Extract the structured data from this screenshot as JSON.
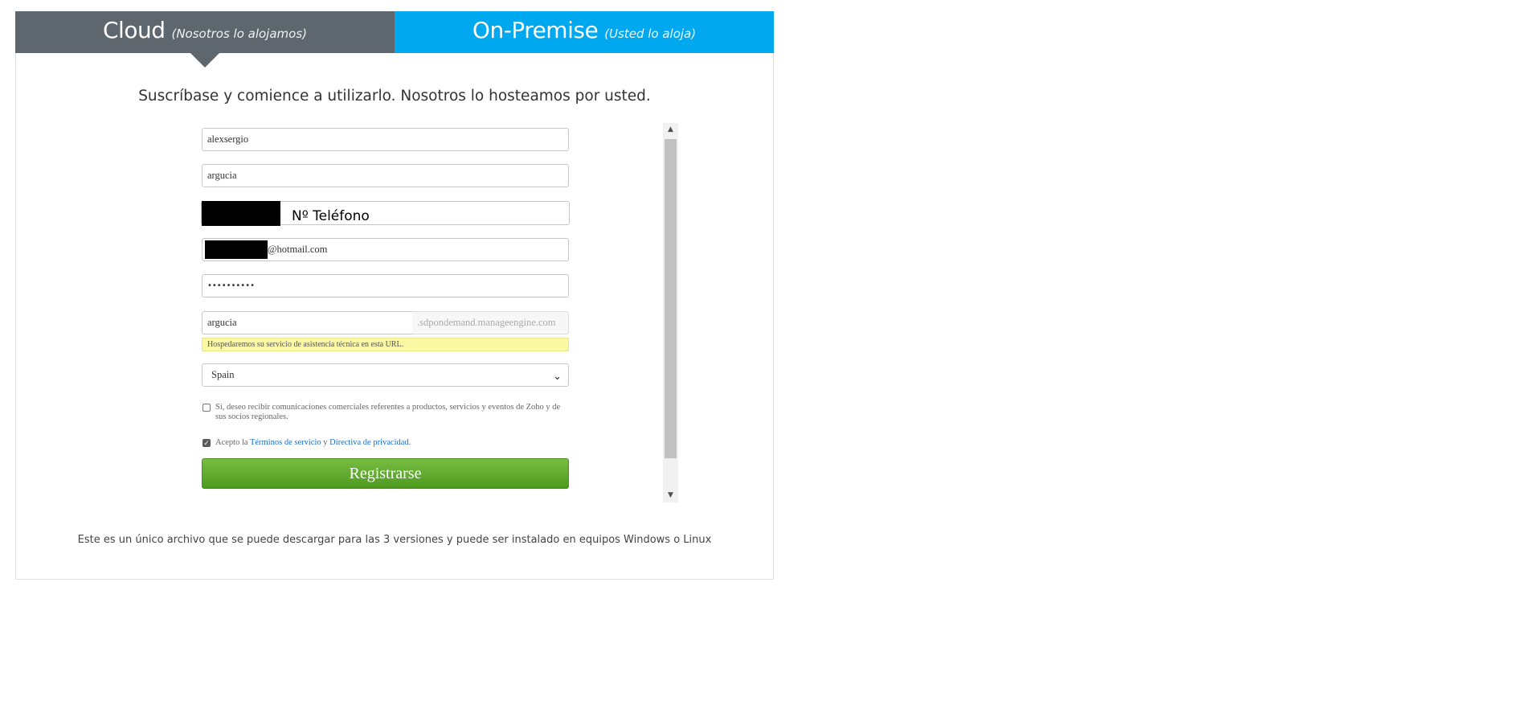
{
  "tabs": {
    "cloud": {
      "title": "Cloud",
      "subtitle": "(Nosotros lo alojamos)"
    },
    "onpremise": {
      "title": "On-Premise",
      "subtitle": "(Usted lo aloja)"
    }
  },
  "headline": "Suscríbase y comience a utilizarlo. Nosotros lo hosteamos por usted.",
  "form": {
    "name_value": "alexsergio",
    "company_value": "argucia",
    "phone_label": "Nº Teléfono",
    "email_suffix": "@hotmail.com",
    "password_value": "••••••••••",
    "portal_value": "argucia",
    "portal_suffix": ".sdpondemand.manageengine.com",
    "portal_hint": "Hospedaremos su servicio de asistencia técnica en esta URL.",
    "country_value": "Spain",
    "marketing_text": "Sí, deseo recibir comunicaciones comerciales referentes a productos, servicios y eventos de Zoho y de sus socios regionales.",
    "terms_prefix": "Acepto la",
    "terms_link": "Términos de servicio",
    "terms_and": "y",
    "privacy_link": "Directiva de privacidad.",
    "submit_label": "Registrarse"
  },
  "footer_note": "Este es un único archivo que se puede descargar para las 3 versiones y puede ser instalado en equipos Windows o Linux",
  "colors": {
    "cloud_tab": "#5d676d",
    "onpremise_tab": "#00a8ef",
    "submit": "#5ba82a",
    "hint_bg": "#fbf8a4"
  }
}
